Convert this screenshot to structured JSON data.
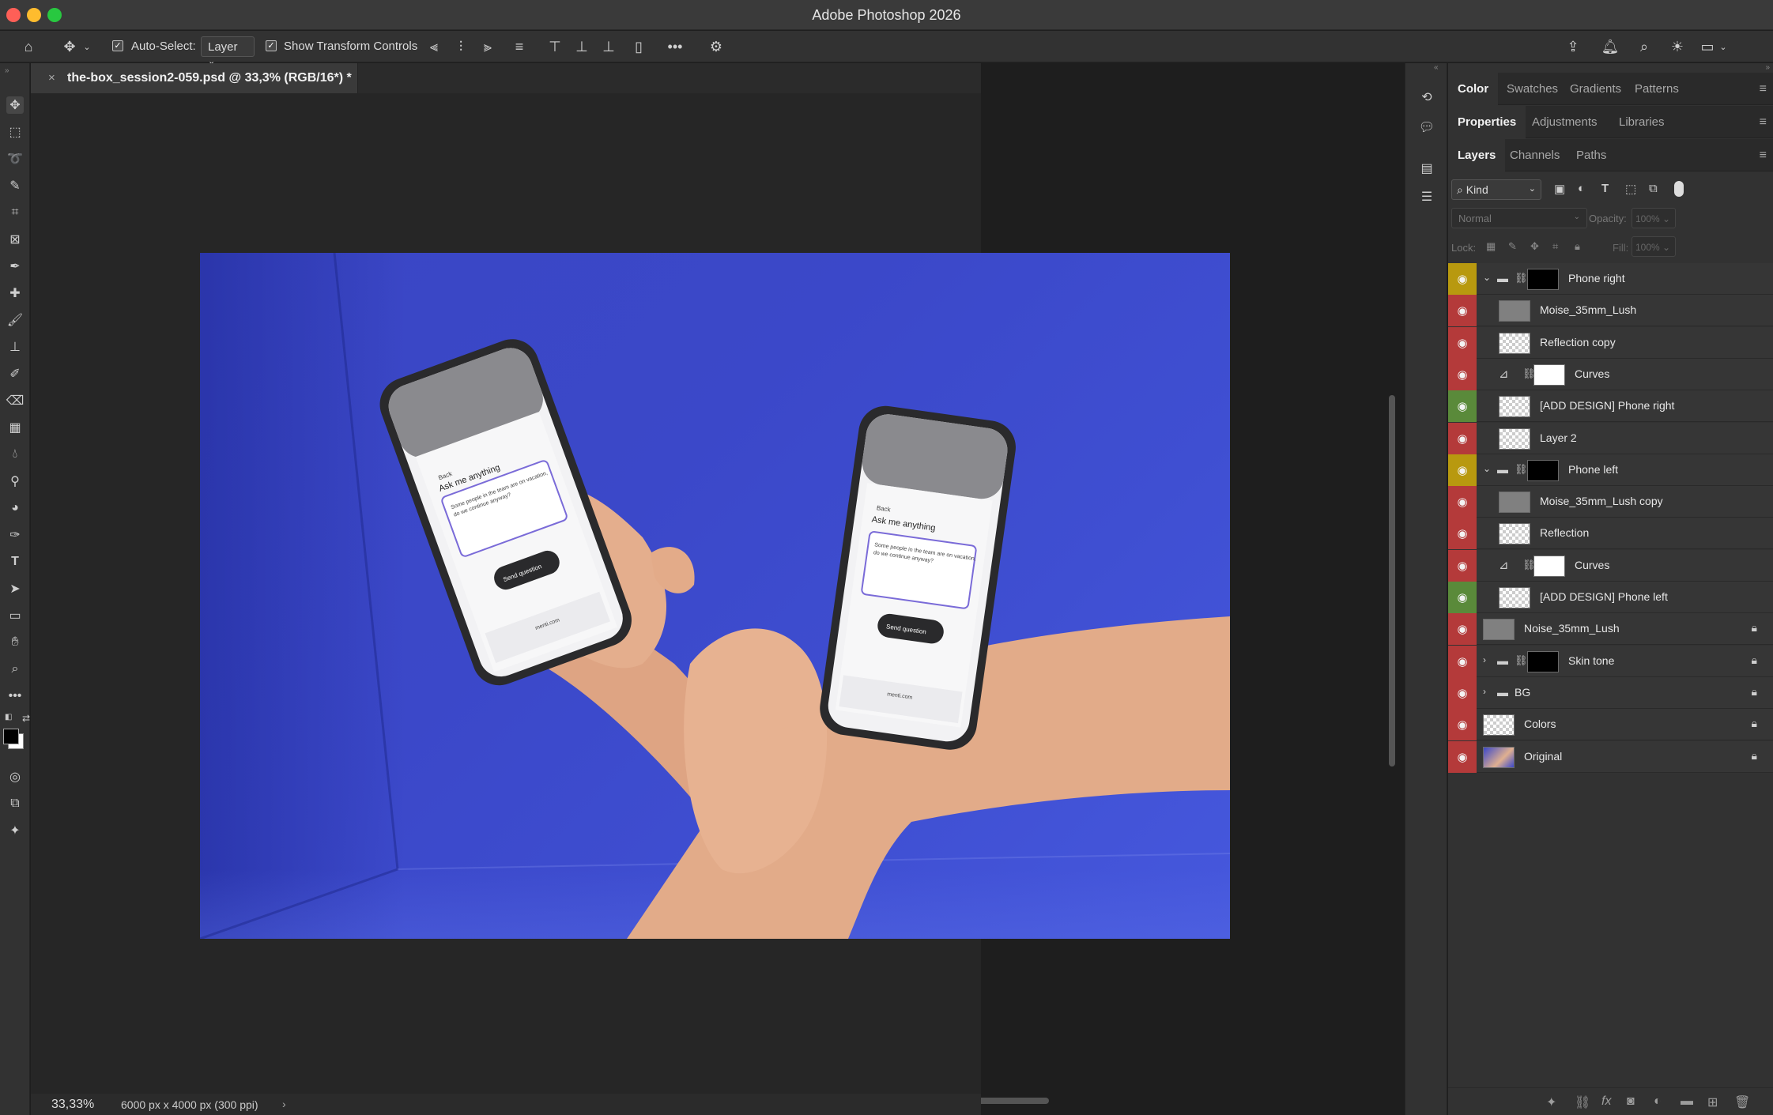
{
  "window": {
    "title": "Adobe Photoshop 2026",
    "traffic_lights": [
      "#fe5f57",
      "#febc2e",
      "#28c840"
    ]
  },
  "options_bar": {
    "auto_select_label": "Auto-Select:",
    "auto_select_checked": true,
    "auto_select_value": "Layer",
    "show_transform_label": "Show Transform Controls",
    "show_transform_checked": true
  },
  "document": {
    "tab_title": "the-box_session2-059.psd @ 33,3% (RGB/16*) *",
    "zoom": "33,33%",
    "dimensions": "6000 px x 4000 px (300 ppi)"
  },
  "photo": {
    "phone_left": {
      "back": "Back",
      "heading": "Ask me anything",
      "question": "Some people in the team are on vacation, do we continue anyway?",
      "button": "Send question",
      "url": "menti.com"
    },
    "phone_right": {
      "back": "Back",
      "heading": "Ask me anything",
      "question": "Some people in the team are on vacation, do we continue anyway?",
      "button": "Send question",
      "url": "menti.com"
    }
  },
  "panels": {
    "group1_tabs": [
      "Color",
      "Swatches",
      "Gradients",
      "Patterns"
    ],
    "group2_tabs": [
      "Properties",
      "Adjustments",
      "Libraries"
    ],
    "group3_tabs": [
      "Layers",
      "Channels",
      "Paths"
    ],
    "filter_kind": "Kind",
    "blend_mode": "Normal",
    "opacity_label": "Opacity:",
    "opacity_value": "100%",
    "lock_label": "Lock:",
    "fill_label": "Fill:",
    "fill_value": "100%"
  },
  "layers": [
    {
      "name": "Phone right",
      "eye": "#b8990f",
      "type": "group-open",
      "indent": 0,
      "thumb": "black",
      "mask": true,
      "lock": false
    },
    {
      "name": "Moise_35mm_Lush",
      "eye": "#b43a3a",
      "type": "layer",
      "indent": 1,
      "thumb": "gray",
      "lock": false
    },
    {
      "name": "Reflection copy",
      "eye": "#b43a3a",
      "type": "layer",
      "indent": 1,
      "thumb": "checker",
      "lock": false
    },
    {
      "name": "Curves",
      "eye": "#b43a3a",
      "type": "adjustment",
      "indent": 1,
      "thumb": "white",
      "lock": false
    },
    {
      "name": "[ADD DESIGN] Phone right",
      "eye": "#5a8a3a",
      "type": "layer",
      "indent": 1,
      "thumb": "checker",
      "lock": false
    },
    {
      "name": "Layer 2",
      "eye": "#b43a3a",
      "type": "layer",
      "indent": 1,
      "thumb": "checker",
      "lock": false
    },
    {
      "name": "Phone left",
      "eye": "#b8990f",
      "type": "group-open",
      "indent": 0,
      "thumb": "black",
      "mask": true,
      "lock": false
    },
    {
      "name": "Moise_35mm_Lush copy",
      "eye": "#b43a3a",
      "type": "layer",
      "indent": 1,
      "thumb": "gray",
      "lock": false
    },
    {
      "name": "Reflection",
      "eye": "#b43a3a",
      "type": "layer",
      "indent": 1,
      "thumb": "checker",
      "lock": false
    },
    {
      "name": "Curves",
      "eye": "#b43a3a",
      "type": "adjustment",
      "indent": 1,
      "thumb": "white",
      "lock": false
    },
    {
      "name": "[ADD DESIGN] Phone left",
      "eye": "#5a8a3a",
      "type": "layer",
      "indent": 1,
      "thumb": "checker",
      "lock": false
    },
    {
      "name": "Noise_35mm_Lush",
      "eye": "#b43a3a",
      "type": "layer",
      "indent": 0,
      "thumb": "gray",
      "lock": true
    },
    {
      "name": "Skin tone",
      "eye": "#b43a3a",
      "type": "group-closed",
      "indent": 0,
      "thumb": "black",
      "mask": true,
      "lock": true
    },
    {
      "name": "BG",
      "eye": "#b43a3a",
      "type": "group-closed-nothumb",
      "indent": 0,
      "lock": true
    },
    {
      "name": "Colors",
      "eye": "#b43a3a",
      "type": "layer",
      "indent": 0,
      "thumb": "checker",
      "lock": true
    },
    {
      "name": "Original",
      "eye": "#b43a3a",
      "type": "layer",
      "indent": 0,
      "thumb": "blue",
      "lock": true
    }
  ]
}
